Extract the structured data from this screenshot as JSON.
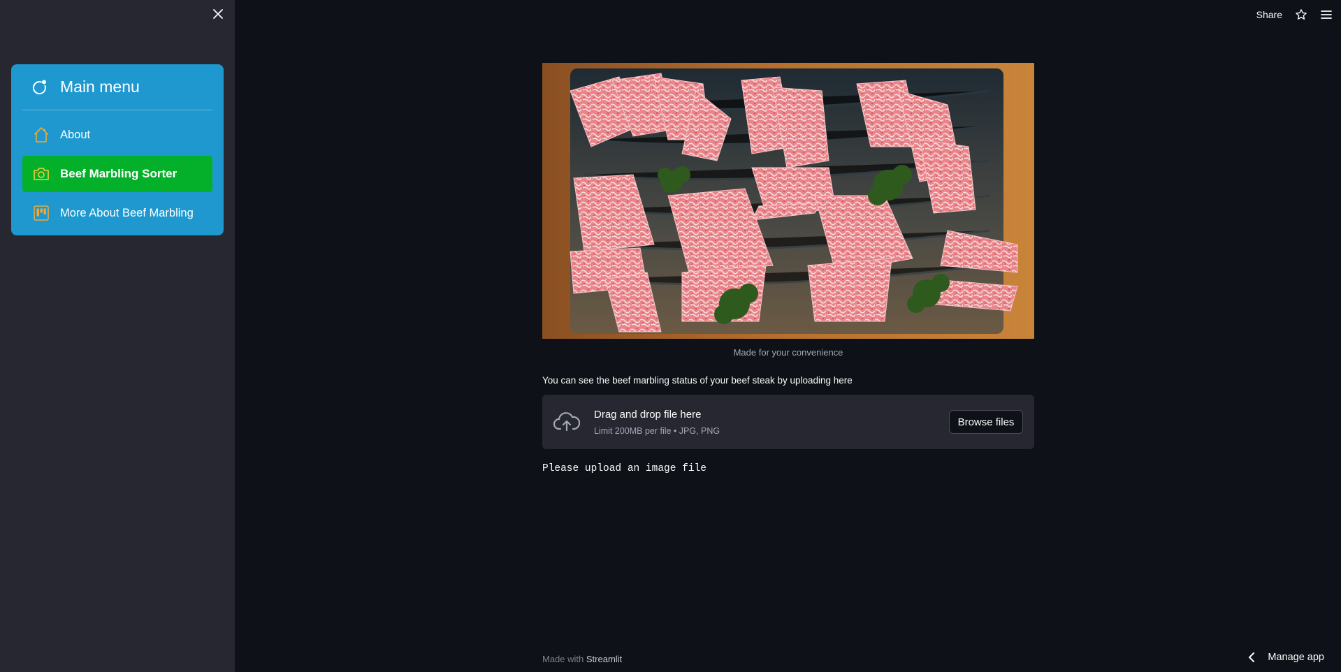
{
  "sidebar": {
    "menu_title": "Main menu",
    "items": [
      {
        "label": "About",
        "icon": "house-icon",
        "active": false
      },
      {
        "label": "Beef Marbling Sorter",
        "icon": "camera-icon",
        "active": true
      },
      {
        "label": "More About Beef Marbling",
        "icon": "kanban-icon",
        "active": false
      }
    ]
  },
  "toolbar": {
    "share_label": "Share"
  },
  "main": {
    "hero_caption": "Made for your convenience",
    "intro_text": "You can see the beef marbling status of your beef steak by uploading here",
    "uploader": {
      "title": "Drag and drop file here",
      "subtitle": "Limit 200MB per file • JPG, PNG",
      "browse_label": "Browse files"
    },
    "status_text": "Please upload an image file"
  },
  "footer": {
    "prefix": "Made with",
    "brand": "Streamlit"
  },
  "manage_app_label": "Manage app",
  "colors": {
    "app_bg": "#0e1117",
    "sidebar_bg": "#262730",
    "menu_bg": "#1e98cf",
    "menu_active": "#04b02a",
    "menu_icon": "#f0a83a"
  }
}
